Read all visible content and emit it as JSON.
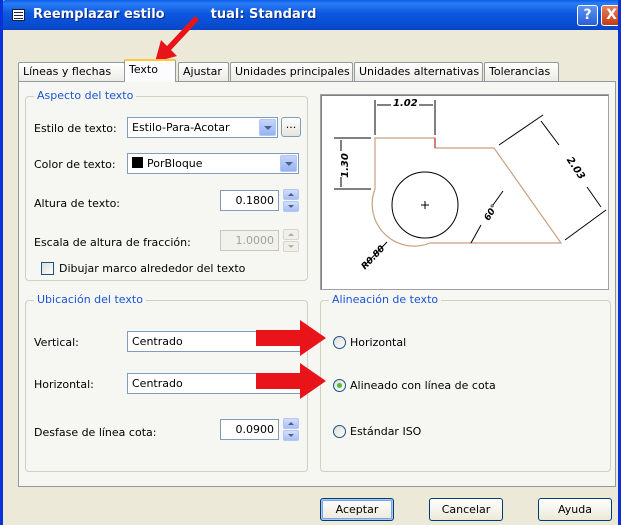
{
  "window": {
    "title": "Reemplazar estilo actual: Standard",
    "title_visible": "Reemplazar estilo",
    "title_visible_end": "tual: Standard",
    "help_label": "?",
    "close_label": "X"
  },
  "tabs": [
    {
      "label": "Líneas y flechas",
      "active": false
    },
    {
      "label": "Texto",
      "active": true
    },
    {
      "label": "Ajustar",
      "active": false
    },
    {
      "label": "Unidades principales",
      "active": false
    },
    {
      "label": "Unidades alternativas",
      "active": false
    },
    {
      "label": "Tolerancias",
      "active": false
    }
  ],
  "appearance": {
    "title": "Aspecto del texto",
    "style_label": "Estilo de texto:",
    "style_value": "Estilo-Para-Acotar",
    "browse_label": "...",
    "color_label": "Color de texto:",
    "color_value": "PorBloque",
    "height_label": "Altura de texto:",
    "height_value": "0.1800",
    "fraction_label": "Escala de altura de fracción:",
    "fraction_value": "1.0000",
    "frame_label": "Dibujar marco alrededor del texto",
    "frame_checked": false
  },
  "placement": {
    "title": "Ubicación del texto",
    "vertical_label": "Vertical:",
    "vertical_value": "Centrado",
    "horizontal_label": "Horizontal:",
    "horizontal_value": "Centrado",
    "offset_label": "Desfase de línea cota:",
    "offset_value": "0.0900"
  },
  "alignment": {
    "title": "Alineación de texto",
    "options": [
      {
        "label": "Horizontal",
        "checked": false
      },
      {
        "label": "Alineado con línea de cota",
        "checked": true
      },
      {
        "label": "Estándar ISO",
        "checked": false
      }
    ]
  },
  "preview": {
    "dim_top": "1.02",
    "dim_left": "1.30",
    "dim_right": "2.03",
    "dim_angle": "60°",
    "dim_radius": "R0.80"
  },
  "buttons": {
    "ok": "Aceptar",
    "cancel": "Cancelar",
    "help": "Ayuda"
  },
  "colors": {
    "title_bar": "#0a58e0",
    "group_title": "#1b54d6",
    "annotation_arrow": "#e8141a"
  }
}
